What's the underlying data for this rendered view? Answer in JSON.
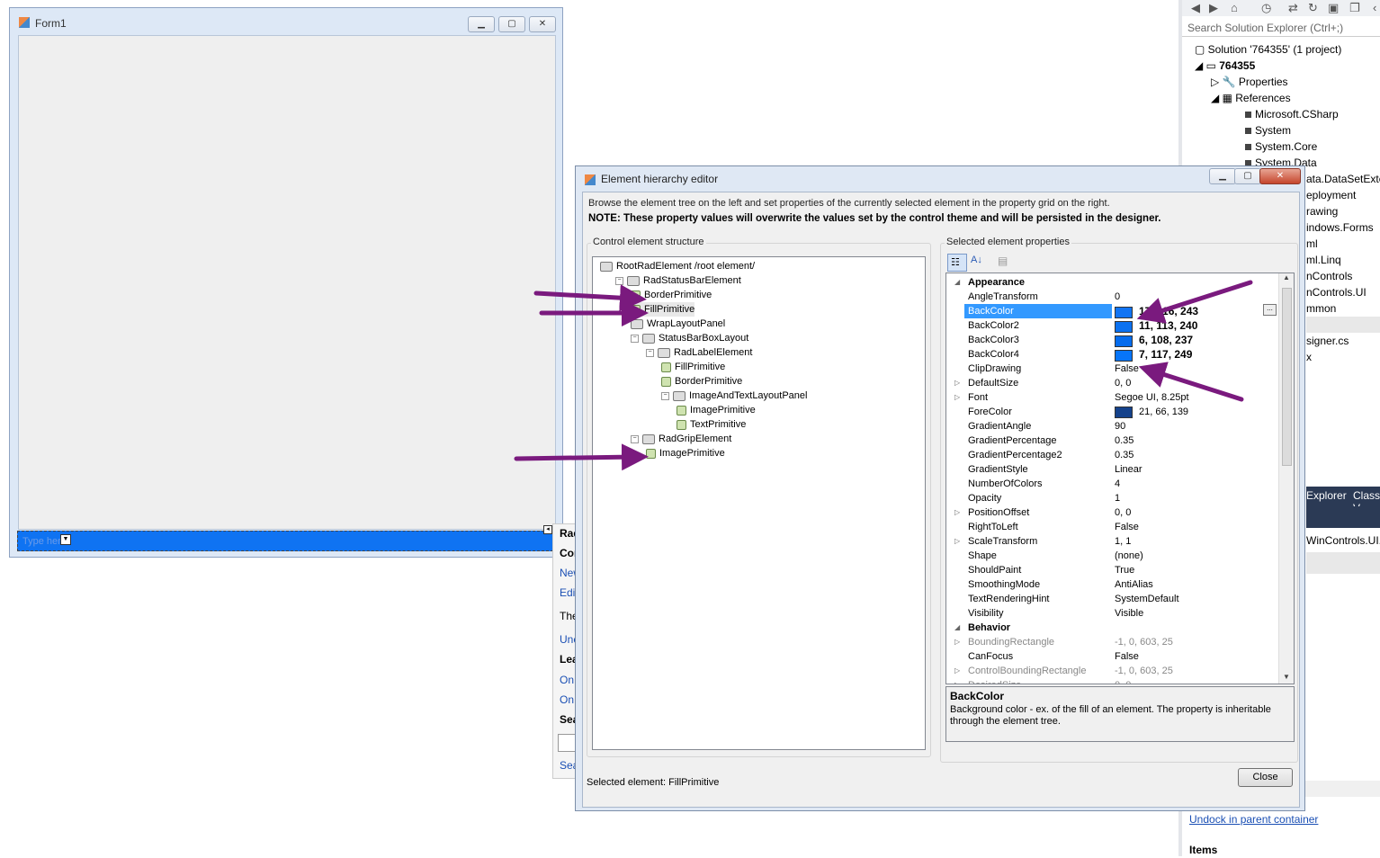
{
  "solution_explorer": {
    "search_placeholder": "Search Solution Explorer (Ctrl+;)",
    "solution": "Solution '764355' (1 project)",
    "project": "764355",
    "properties": "Properties",
    "references": "References",
    "refs": [
      "Microsoft.CSharp",
      "System",
      "System.Core",
      "System.Data"
    ],
    "partial_items": [
      "ata.DataSetExter",
      "eployment",
      "rawing",
      "indows.Forms",
      "ml",
      "ml.Linq",
      "nControls",
      "nControls.UI",
      "mmon",
      "signer.cs",
      "x"
    ],
    "tabs": [
      "Explorer",
      "Class V"
    ],
    "props_title": "WinControls.UI.",
    "undock_link": "Undock in parent container",
    "items_heading": "Items"
  },
  "form1": {
    "title": "Form1",
    "status_placeholder": "Type here"
  },
  "smart_tag": {
    "items": [
      "Rad",
      "Con",
      "New",
      "Edi",
      "The",
      "Unc",
      "Lea",
      "On",
      "On",
      "Sea",
      "Sea"
    ]
  },
  "dialog": {
    "title": "Element hierarchy editor",
    "description": "Browse the element tree on the left and set properties of the currently selected element in the property grid on the right.",
    "note": "NOTE: These property values will overwrite the values set by the control theme and will be persisted in the designer.",
    "tree_group_label": "Control element structure",
    "props_group_label": "Selected element properties",
    "tree": [
      {
        "label": "RootRadElement /root element/",
        "level": 0,
        "kind": "node",
        "exp": ""
      },
      {
        "label": "RadStatusBarElement",
        "level": 1,
        "kind": "node",
        "exp": "-"
      },
      {
        "label": "BorderPrimitive",
        "level": 2,
        "kind": "leaf",
        "exp": ""
      },
      {
        "label": "FillPrimitive",
        "level": 2,
        "kind": "leaf",
        "exp": ""
      },
      {
        "label": "WrapLayoutPanel",
        "level": 2,
        "kind": "node",
        "exp": ""
      },
      {
        "label": "StatusBarBoxLayout",
        "level": 2,
        "kind": "node",
        "exp": "-"
      },
      {
        "label": "RadLabelElement",
        "level": 3,
        "kind": "node",
        "exp": "-"
      },
      {
        "label": "FillPrimitive",
        "level": 4,
        "kind": "leaf",
        "exp": ""
      },
      {
        "label": "BorderPrimitive",
        "level": 4,
        "kind": "leaf",
        "exp": ""
      },
      {
        "label": "ImageAndTextLayoutPanel",
        "level": 4,
        "kind": "node",
        "exp": "-"
      },
      {
        "label": "ImagePrimitive",
        "level": 5,
        "kind": "leaf",
        "exp": ""
      },
      {
        "label": "TextPrimitive",
        "level": 5,
        "kind": "leaf",
        "exp": ""
      },
      {
        "label": "RadGripElement",
        "level": 2,
        "kind": "node",
        "exp": "-"
      },
      {
        "label": "ImagePrimitive",
        "level": 3,
        "kind": "leaf",
        "exp": ""
      }
    ],
    "properties": [
      {
        "name": "Appearance",
        "value": "",
        "category": true
      },
      {
        "name": "AngleTransform",
        "value": "0"
      },
      {
        "name": "BackColor",
        "value": "17, 116, 243",
        "color": "#1174f3",
        "bold": true,
        "selected": true
      },
      {
        "name": "BackColor2",
        "value": "11, 113, 240",
        "color": "#0b71f0",
        "bold": true
      },
      {
        "name": "BackColor3",
        "value": "6, 108, 237",
        "color": "#066ced",
        "bold": true
      },
      {
        "name": "BackColor4",
        "value": "7, 117, 249",
        "color": "#0775f9",
        "bold": true
      },
      {
        "name": "ClipDrawing",
        "value": "False"
      },
      {
        "name": "DefaultSize",
        "value": "0, 0",
        "expandable": true
      },
      {
        "name": "Font",
        "value": "Segoe UI, 8.25pt",
        "expandable": true
      },
      {
        "name": "ForeColor",
        "value": "21, 66, 139",
        "color": "#15428b"
      },
      {
        "name": "GradientAngle",
        "value": "90"
      },
      {
        "name": "GradientPercentage",
        "value": "0.35"
      },
      {
        "name": "GradientPercentage2",
        "value": "0.35"
      },
      {
        "name": "GradientStyle",
        "value": "Linear"
      },
      {
        "name": "NumberOfColors",
        "value": "4"
      },
      {
        "name": "Opacity",
        "value": "1"
      },
      {
        "name": "PositionOffset",
        "value": "0, 0",
        "expandable": true
      },
      {
        "name": "RightToLeft",
        "value": "False"
      },
      {
        "name": "ScaleTransform",
        "value": "1, 1",
        "expandable": true
      },
      {
        "name": "Shape",
        "value": "(none)"
      },
      {
        "name": "ShouldPaint",
        "value": "True"
      },
      {
        "name": "SmoothingMode",
        "value": "AntiAlias"
      },
      {
        "name": "TextRenderingHint",
        "value": "SystemDefault"
      },
      {
        "name": "Visibility",
        "value": "Visible"
      },
      {
        "name": "Behavior",
        "value": "",
        "category": true
      },
      {
        "name": "BoundingRectangle",
        "value": "-1, 0, 603, 25",
        "expandable": true,
        "grey": true
      },
      {
        "name": "CanFocus",
        "value": "False"
      },
      {
        "name": "ControlBoundingRectangle",
        "value": "-1, 0, 603, 25",
        "expandable": true,
        "grey": true
      },
      {
        "name": "DesiredSize",
        "value": "0, 0",
        "expandable": true,
        "grey": true
      }
    ],
    "desc_title": "BackColor",
    "desc_text": "Background color - ex. of the fill of an element. The property is inheritable through the element tree.",
    "selected_element": "Selected element: FillPrimitive",
    "close_label": "Close"
  },
  "annotation_color": "#7a1a7e"
}
